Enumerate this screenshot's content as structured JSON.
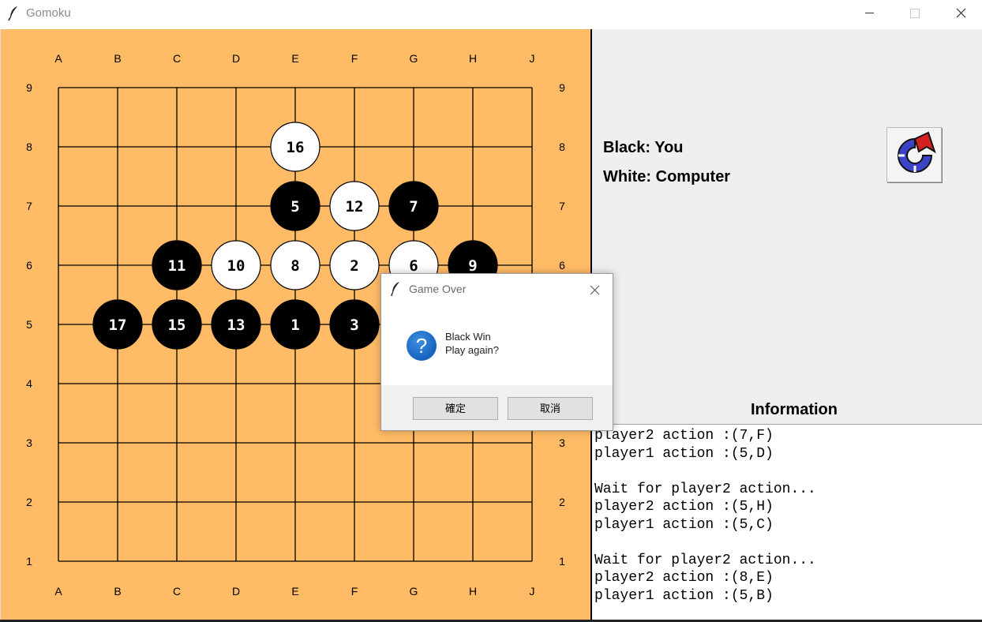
{
  "window": {
    "title": "Gomoku",
    "app_icon": "feather-icon",
    "controls": [
      "minimize-icon",
      "maximize-icon",
      "close-icon"
    ]
  },
  "board": {
    "columns": [
      "A",
      "B",
      "C",
      "D",
      "E",
      "F",
      "G",
      "H",
      "J"
    ],
    "rows": [
      "9",
      "8",
      "7",
      "6",
      "5",
      "4",
      "3",
      "2",
      "1"
    ],
    "board_color": "#ffbb66",
    "stones": [
      {
        "number": "1",
        "color": "black",
        "col": "E",
        "row": "5"
      },
      {
        "number": "2",
        "color": "white",
        "col": "F",
        "row": "6"
      },
      {
        "number": "3",
        "color": "black",
        "col": "F",
        "row": "5"
      },
      {
        "number": "5",
        "color": "black",
        "col": "E",
        "row": "7"
      },
      {
        "number": "6",
        "color": "white",
        "col": "G",
        "row": "6"
      },
      {
        "number": "7",
        "color": "black",
        "col": "G",
        "row": "7"
      },
      {
        "number": "8",
        "color": "white",
        "col": "E",
        "row": "6"
      },
      {
        "number": "9",
        "color": "black",
        "col": "H",
        "row": "6"
      },
      {
        "number": "10",
        "color": "white",
        "col": "D",
        "row": "6"
      },
      {
        "number": "11",
        "color": "black",
        "col": "C",
        "row": "6"
      },
      {
        "number": "12",
        "color": "white",
        "col": "F",
        "row": "7"
      },
      {
        "number": "13",
        "color": "black",
        "col": "D",
        "row": "5"
      },
      {
        "number": "15",
        "color": "black",
        "col": "C",
        "row": "5"
      },
      {
        "number": "16",
        "color": "white",
        "col": "E",
        "row": "8"
      },
      {
        "number": "17",
        "color": "black",
        "col": "B",
        "row": "5"
      }
    ]
  },
  "side": {
    "black_label": "Black: You",
    "white_label": "White: Computer",
    "restart_icon": "restart-icon",
    "info_heading": "Information"
  },
  "log": [
    "player2 action :(7,F)",
    "player1 action :(5,D)",
    "",
    "Wait for player2 action...",
    "player2 action :(5,H)",
    "player1 action :(5,C)",
    "",
    "Wait for player2 action...",
    "player2 action :(8,E)",
    "player1 action :(5,B)"
  ],
  "dialog": {
    "title": "Game Over",
    "icon": "question-icon",
    "message_line1": "Black Win",
    "message_line2": "Play again?",
    "ok_label": "確定",
    "cancel_label": "取消"
  }
}
